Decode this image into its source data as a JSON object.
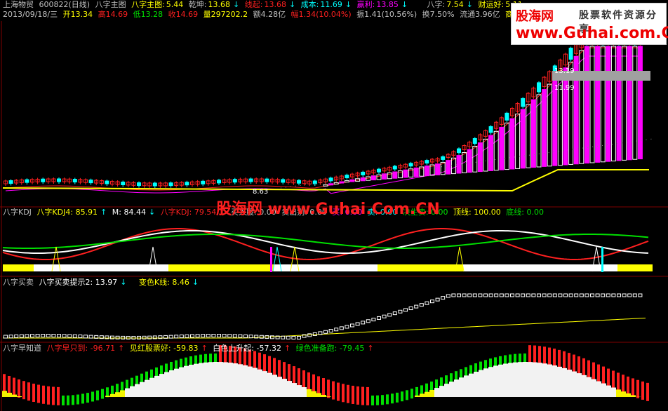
{
  "colors": {
    "bg": "#000000",
    "red": "#ff2020",
    "yellow": "#ffff00",
    "green": "#00e000",
    "magenta": "#ff00ff",
    "white": "#ffffff",
    "cyan": "#00ffff"
  },
  "header": {
    "stock_name": "上海物贸",
    "stock_code": "600822(日线)",
    "indicator": "八字主图",
    "i1_label": "八字主图:",
    "i1_val": "5.44",
    "i2_label": "乾坤:",
    "i2_val": "13.68",
    "i3_label": "线起:",
    "i3_val": "13.68",
    "i4_label": "成本:",
    "i4_val": "11.69",
    "i5_label": "赢利:",
    "i5_val": "13.85",
    "i6_label": "八字:",
    "i6_val": "7.54",
    "i7_label": "财运好:",
    "i7_val": "5.11"
  },
  "quote": {
    "date": "2013/09/18/三",
    "open": "开13.34",
    "high": "高14.69",
    "low": "低13.28",
    "close": "收14.69",
    "volume": "量297202.2",
    "amount": "额4.28亿",
    "change": "幅1.34(10.04%)",
    "amplitude": "振1.41(10.56%)",
    "turnover": "换7.50%",
    "float": "流通3.96亿",
    "sector": "商贸代理"
  },
  "price_labels": {
    "p1": "13.19",
    "p2": "11.99",
    "p3": "8.63"
  },
  "kdj": {
    "name": "八字KDJ",
    "l1": "八字KDJ4: 85.91",
    "l2": "M: 84.44",
    "l3": "八字KDJ: 79.54",
    "l4": "买入股: 0.00",
    "l5": "卖出别: 0.00",
    "l6": "买: 0.00",
    "l7": "卖: 0.00",
    "l8": "决生卖: 0.00",
    "l9": "顶线: 100.00",
    "l10": "底线: 0.00"
  },
  "trade": {
    "name": "八字买卖",
    "l1": "八字买卖提示2: 13.97",
    "l2": "变色K线: 8.46"
  },
  "early": {
    "name": "八字早知道",
    "l1": "八字早只到: -96.71",
    "l2": "见红股票好: -59.83",
    "l3": "白色上升起: -57.32",
    "l4": "绿色准备跑: -79.45"
  },
  "logo": {
    "title": "股海网",
    "sub": "股票软件资源分享",
    "url": "www.Guhai.com.CN"
  },
  "watermark": "股海网 www.Guhai.Com.CN"
}
